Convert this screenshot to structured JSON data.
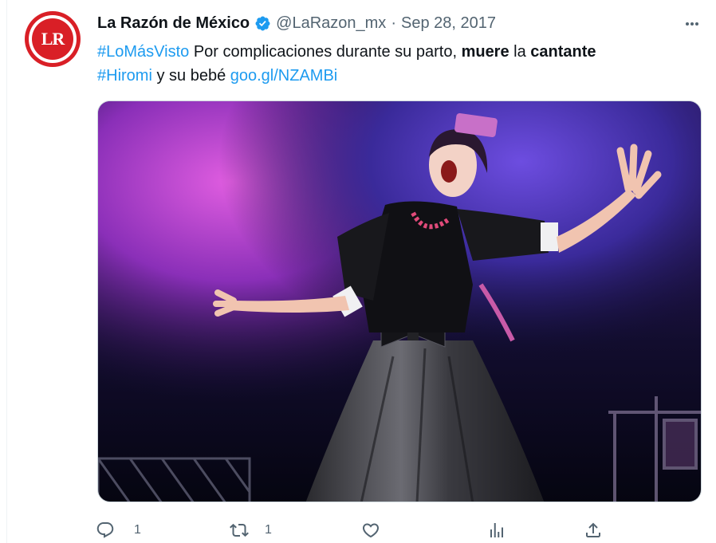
{
  "author": {
    "display_name": "La Razón de México",
    "handle": "@LaRazon_mx",
    "separator": "·",
    "date": "Sep 28, 2017",
    "avatar_text": "LR",
    "verified": true
  },
  "tweet": {
    "hashtag1": "#LoMásVisto",
    "text1": " Por complicaciones durante su parto, ",
    "bold1": "muere",
    "text2": " la ",
    "bold2": "cantante",
    "hashtag2": "#Hiromi",
    "text3": " y su bebé ",
    "link": "goo.gl/NZAMBi"
  },
  "actions": {
    "reply_count": "1",
    "retweet_count": "1"
  },
  "colors": {
    "link": "#1d9bf0",
    "secondary_text": "#536471",
    "brand_red": "#d91f26",
    "verified": "#1d9bf0"
  },
  "icons": [
    "verified-badge-icon",
    "more-icon",
    "reply-icon",
    "retweet-icon",
    "like-icon",
    "analytics-icon",
    "share-icon"
  ]
}
